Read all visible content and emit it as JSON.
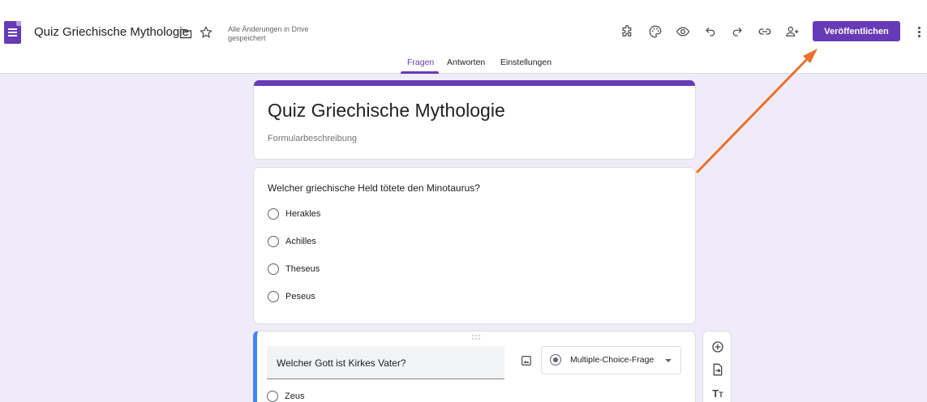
{
  "header": {
    "doc_title": "Quiz Griechische Mythologie",
    "save_status": "Alle Änderungen in Drive gespeichert",
    "publish_label": "Veröffentlichen",
    "icons": [
      "forms-app-icon",
      "folder-icon",
      "star-icon",
      "addon-icon",
      "palette-icon",
      "preview-eye-icon",
      "undo-icon",
      "redo-icon",
      "link-icon",
      "add-collaborator-icon",
      "more-vert-icon"
    ]
  },
  "tabs": [
    {
      "label": "Fragen",
      "active": true
    },
    {
      "label": "Antworten",
      "active": false
    },
    {
      "label": "Einstellungen",
      "active": false
    }
  ],
  "form": {
    "title": "Quiz Griechische Mythologie",
    "description_placeholder": "Formularbeschreibung"
  },
  "questions": [
    {
      "text": "Welcher griechische Held tötete den Minotaurus?",
      "options": [
        "Herakles",
        "Achilles",
        "Theseus",
        "Peseus"
      ]
    },
    {
      "text": "Welcher Gott ist Kirkes Vater?",
      "type": "Multiple-Choice-Frage",
      "options": [
        "Zeus"
      ]
    }
  ],
  "side_toolbar": [
    "add-question-icon",
    "import-questions-icon",
    "add-title-text-icon"
  ],
  "colors": {
    "accent": "#673ab7",
    "background": "#f0ebf8",
    "active_question_border": "#4285f4",
    "annotation_arrow": "#e8712c"
  }
}
